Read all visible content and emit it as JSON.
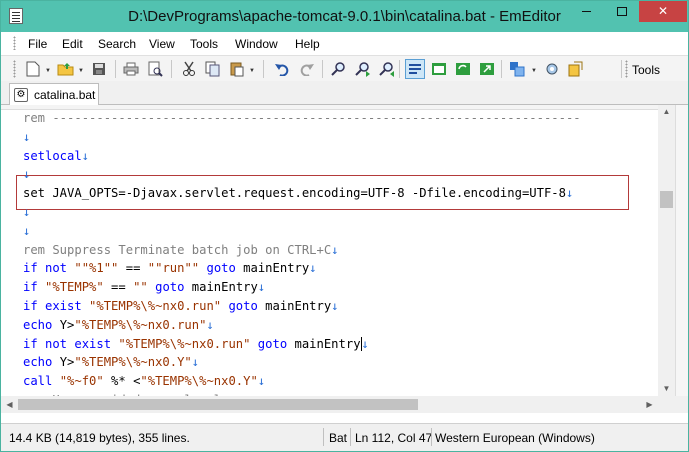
{
  "window": {
    "title": "D:\\DevPrograms\\apache-tomcat-9.0.1\\bin\\catalina.bat - EmEditor",
    "close_label": "✕"
  },
  "menu": [
    "File",
    "Edit",
    "Search",
    "View",
    "Tools",
    "Window",
    "Help"
  ],
  "toolbar": {
    "tools_label": "Tools",
    "icons": [
      "new-file-icon",
      "open-folder-icon",
      "save-icon",
      "print-icon",
      "print-preview-icon",
      "cut-icon",
      "copy-icon",
      "paste-icon",
      "undo-icon",
      "redo-icon",
      "find-icon",
      "find-next-icon",
      "find-prev-icon",
      "word-wrap-icon",
      "ruler-icon",
      "refresh-icon",
      "export-icon",
      "plugin-icon",
      "customize-icon",
      "macros-icon"
    ]
  },
  "tab": {
    "label": "catalina.bat"
  },
  "editor": {
    "lines": [
      {
        "type": "comment",
        "text": "rem ------------------------------------------------------------------------"
      },
      {
        "type": "blank",
        "text": ""
      },
      {
        "type": "keyword",
        "text": "setlocal"
      },
      {
        "type": "blank",
        "text": ""
      },
      {
        "type": "plain",
        "text": "set JAVA_OPTS=-Djavax.servlet.request.encoding=UTF-8 -Dfile.encoding=UTF-8"
      },
      {
        "type": "blank",
        "text": ""
      },
      {
        "type": "blank",
        "text": ""
      },
      {
        "type": "comment",
        "text": "rem Suppress Terminate batch job on CTRL+C"
      },
      {
        "type": "code",
        "parts": [
          [
            "k",
            "if not "
          ],
          [
            "s",
            "\"\"%1\"\""
          ],
          [
            "t",
            " == "
          ],
          [
            "s",
            "\"\"run\"\""
          ],
          [
            "k",
            " goto "
          ],
          [
            "t",
            "mainEntry"
          ]
        ]
      },
      {
        "type": "code",
        "parts": [
          [
            "k",
            "if "
          ],
          [
            "s",
            "\"%TEMP%\""
          ],
          [
            "t",
            " == "
          ],
          [
            "s",
            "\"\""
          ],
          [
            "k",
            " goto "
          ],
          [
            "t",
            "mainEntry"
          ]
        ]
      },
      {
        "type": "code",
        "parts": [
          [
            "k",
            "if exist "
          ],
          [
            "s",
            "\"%TEMP%\\%~nx0.run\""
          ],
          [
            "k",
            " goto "
          ],
          [
            "t",
            "mainEntry"
          ]
        ]
      },
      {
        "type": "code",
        "parts": [
          [
            "k",
            "echo "
          ],
          [
            "t",
            "Y>"
          ],
          [
            "s",
            "\"%TEMP%\\%~nx0.run\""
          ]
        ]
      },
      {
        "type": "code",
        "parts": [
          [
            "k",
            "if not exist "
          ],
          [
            "s",
            "\"%TEMP%\\%~nx0.run\""
          ],
          [
            "k",
            " goto "
          ],
          [
            "t",
            "mainEntry"
          ]
        ]
      },
      {
        "type": "code",
        "parts": [
          [
            "k",
            "echo "
          ],
          [
            "t",
            "Y>"
          ],
          [
            "s",
            "\"%TEMP%\\%~nx0.Y\""
          ]
        ]
      },
      {
        "type": "code",
        "parts": [
          [
            "k",
            "call "
          ],
          [
            "s",
            "\"%~f0\""
          ],
          [
            "t",
            " %* <"
          ],
          [
            "s",
            "\"%TEMP%\\%~nx0.Y\""
          ]
        ]
      },
      {
        "type": "comment",
        "text": "rem Use provided errorlevel"
      }
    ],
    "newline_glyph": "↓"
  },
  "status": {
    "size": "14.4 KB (14,819 bytes), 355 lines.",
    "filetype": "Bat",
    "position": "Ln 112, Col 47",
    "encoding": "Western European (Windows)"
  }
}
